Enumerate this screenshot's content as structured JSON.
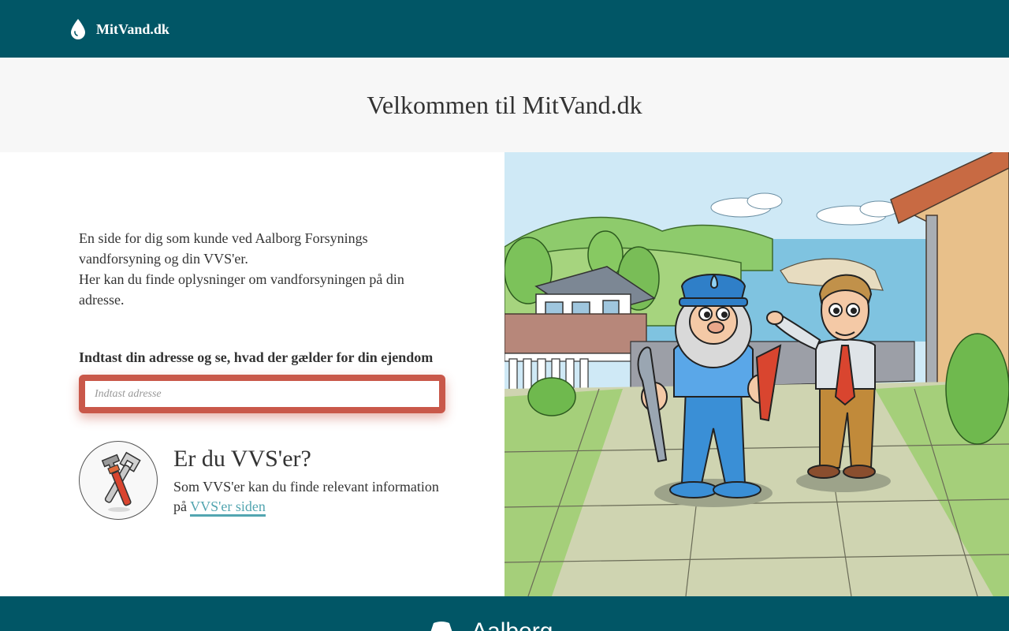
{
  "header": {
    "brand_name": "MitVand.dk",
    "brand_icon": "water-drop-icon"
  },
  "hero": {
    "title": "Velkommen til MitVand.dk"
  },
  "intro": {
    "line1": "En side for dig som kunde ved Aalborg Forsynings vandforsyning og din VVS'er.",
    "line2": "Her kan du finde oplysninger om vandforsyningen på din adresse."
  },
  "search": {
    "label": "Indtast din adresse og se, hvad der gælder for din ejendom",
    "placeholder": "Indtast adresse",
    "value": ""
  },
  "vvs": {
    "icon": "plumbing-tools-icon",
    "title": "Er du VVS'er?",
    "text": "Som VVS'er kan du finde relevant information på",
    "link_label": "VVS'er siden"
  },
  "footer": {
    "logo_text": "Aalborg"
  },
  "colors": {
    "primary": "#015666",
    "accent": "#c9584a",
    "link": "#52a5b0",
    "hero_bg": "#f7f7f7"
  }
}
